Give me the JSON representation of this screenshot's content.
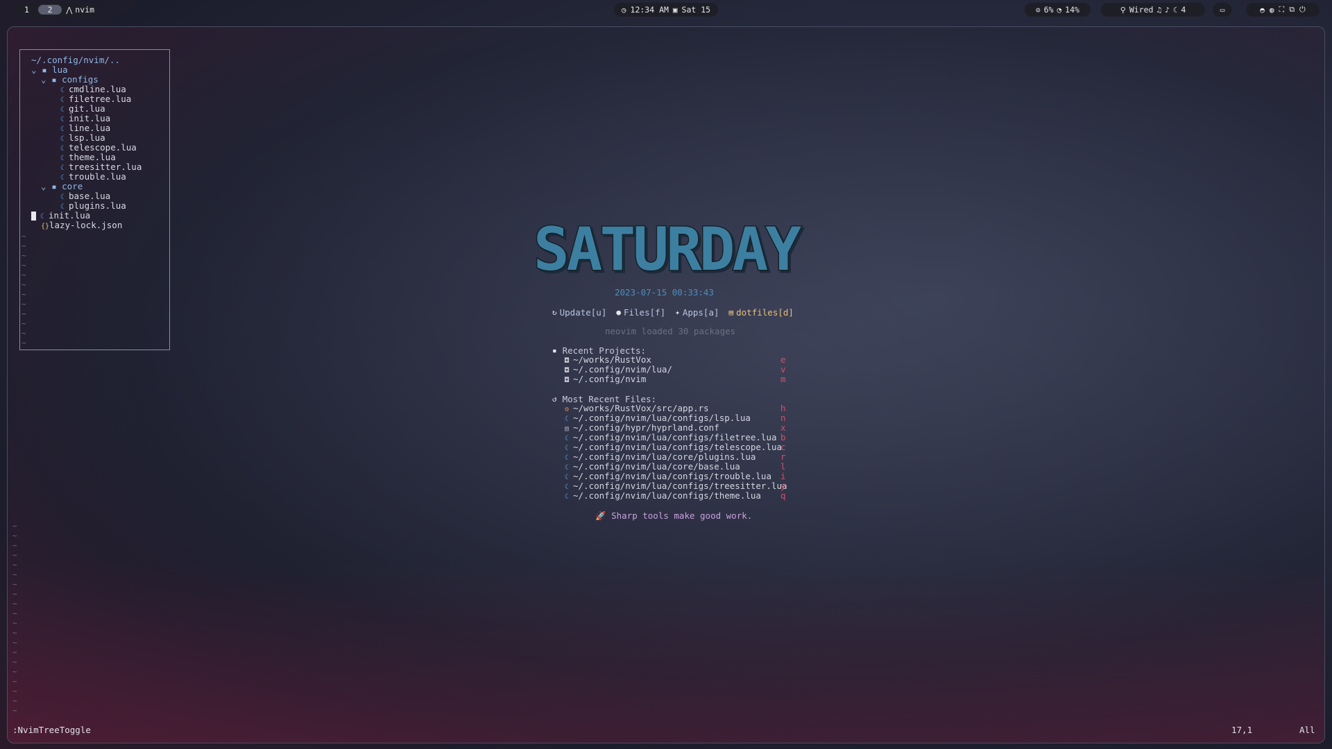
{
  "topbar": {
    "workspaces": [
      "1",
      "2"
    ],
    "active_workspace": "2",
    "app_name": "nvim",
    "clock": "12:34 AM",
    "date": "Sat 15",
    "cpu": "6%",
    "memory": "14%",
    "network": "Wired",
    "notification_count": "4"
  },
  "tree": {
    "root": "~/.config/nvim/..",
    "items": [
      {
        "label": "lua",
        "kind": "dir"
      },
      {
        "label": "configs",
        "kind": "dir"
      },
      {
        "label": "cmdline.lua",
        "kind": "lua"
      },
      {
        "label": "filetree.lua",
        "kind": "lua"
      },
      {
        "label": "git.lua",
        "kind": "lua"
      },
      {
        "label": "init.lua",
        "kind": "lua"
      },
      {
        "label": "line.lua",
        "kind": "lua"
      },
      {
        "label": "lsp.lua",
        "kind": "lua"
      },
      {
        "label": "telescope.lua",
        "kind": "lua"
      },
      {
        "label": "theme.lua",
        "kind": "lua"
      },
      {
        "label": "treesitter.lua",
        "kind": "lua"
      },
      {
        "label": "trouble.lua",
        "kind": "lua"
      },
      {
        "label": "core",
        "kind": "dir"
      },
      {
        "label": "base.lua",
        "kind": "lua"
      },
      {
        "label": "plugins.lua",
        "kind": "lua"
      },
      {
        "label": "init.lua",
        "kind": "lua"
      },
      {
        "label": "lazy-lock.json",
        "kind": "json"
      }
    ]
  },
  "dashboard": {
    "banner": "SATURDAY",
    "datetime": "2023-07-15 00:33:43",
    "buttons": [
      {
        "label": "Update[u]",
        "color": "#b8c4e0"
      },
      {
        "label": "Files[f]",
        "color": "#b8c4e0"
      },
      {
        "label": "Apps[a]",
        "color": "#b8c4e0"
      },
      {
        "label": "dotfiles[d]",
        "color": "#e6c07b"
      }
    ],
    "loaded": "neovim loaded 30 packages",
    "recent_projects_title": "Recent Projects:",
    "recent_projects": [
      {
        "path": "~/works/RustVox",
        "key": "e"
      },
      {
        "path": "~/.config/nvim/lua/",
        "key": "v"
      },
      {
        "path": "~/.config/nvim",
        "key": "m"
      }
    ],
    "recent_files_title": "Most Recent Files:",
    "recent_files": [
      {
        "path": "~/works/RustVox/src/app.rs",
        "key": "h",
        "icon": "rust-icon"
      },
      {
        "path": "~/.config/nvim/lua/configs/lsp.lua",
        "key": "n",
        "icon": "lua-icon"
      },
      {
        "path": "~/.config/hypr/hyprland.conf",
        "key": "x",
        "icon": "config-icon"
      },
      {
        "path": "~/.config/nvim/lua/configs/filetree.lua",
        "key": "b",
        "icon": "lua-icon"
      },
      {
        "path": "~/.config/nvim/lua/configs/telescope.lua",
        "key": "c",
        "icon": "lua-icon"
      },
      {
        "path": "~/.config/nvim/lua/core/plugins.lua",
        "key": "r",
        "icon": "lua-icon"
      },
      {
        "path": "~/.config/nvim/lua/core/base.lua",
        "key": "l",
        "icon": "lua-icon"
      },
      {
        "path": "~/.config/nvim/lua/configs/trouble.lua",
        "key": "i",
        "icon": "lua-icon"
      },
      {
        "path": "~/.config/nvim/lua/configs/treesitter.lua",
        "key": "y",
        "icon": "lua-icon"
      },
      {
        "path": "~/.config/nvim/lua/configs/theme.lua",
        "key": "q",
        "icon": "lua-icon"
      }
    ],
    "footer": "Sharp tools make good work."
  },
  "statusline": {
    "command": ":NvimTreeToggle",
    "position": "17,1",
    "scroll": "All"
  },
  "colors": {
    "accent_blue": "#4e8cb8",
    "key_red": "#d0506a",
    "banner_teal": "#3d7fa0"
  }
}
